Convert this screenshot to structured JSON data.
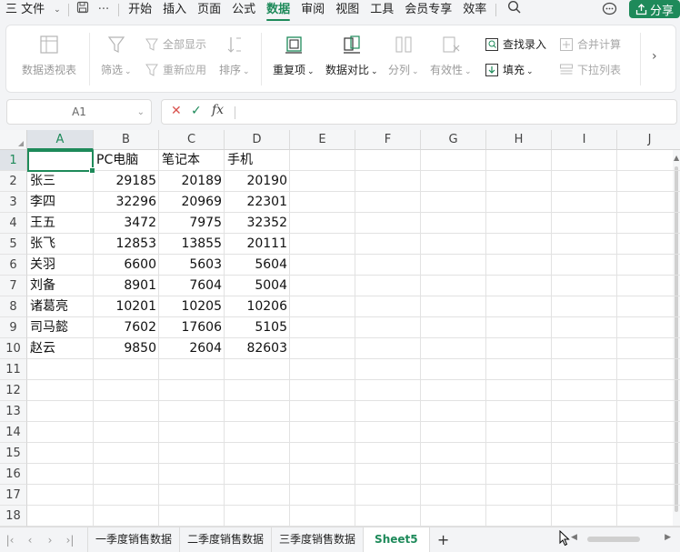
{
  "menubar": {
    "file_label": "三 文件",
    "ellipsis": "···",
    "tabs": [
      "开始",
      "插入",
      "页面",
      "公式",
      "数据",
      "审阅",
      "视图",
      "工具",
      "会员专享",
      "效率"
    ],
    "active_tab": "数据",
    "share_label": "分享"
  },
  "ribbon": {
    "pivot_table": "数据透视表",
    "filter": "筛选",
    "show_all": "全部显示",
    "reapply": "重新应用",
    "sort": "排序",
    "duplicates": "重复项",
    "compare": "数据对比",
    "split": "分列",
    "validity": "有效性",
    "lookup_entry": "查找录入",
    "fill": "填充",
    "merge_calc": "合并计算",
    "dropdown_list": "下拉列表"
  },
  "formula_bar": {
    "name_box": "A1",
    "fx": "fx",
    "content": ""
  },
  "sheet": {
    "columns": [
      "A",
      "B",
      "C",
      "D",
      "E",
      "F",
      "G",
      "H",
      "I",
      "J"
    ],
    "rows": [
      "1",
      "2",
      "3",
      "4",
      "5",
      "6",
      "7",
      "8",
      "9",
      "10",
      "11",
      "12",
      "13",
      "14",
      "15",
      "16",
      "17",
      "18"
    ],
    "header_row": [
      "",
      "PC电脑",
      "笔记本",
      "手机"
    ],
    "data": [
      [
        "张三",
        "29185",
        "20189",
        "20190"
      ],
      [
        "李四",
        "32296",
        "20969",
        "22301"
      ],
      [
        "王五",
        "3472",
        "7975",
        "32352"
      ],
      [
        "张飞",
        "12853",
        "13855",
        "20111"
      ],
      [
        "关羽",
        "6600",
        "5603",
        "5604"
      ],
      [
        "刘备",
        "8901",
        "7604",
        "5004"
      ],
      [
        "诸葛亮",
        "10201",
        "10205",
        "10206"
      ],
      [
        "司马懿",
        "7602",
        "17606",
        "5105"
      ],
      [
        "赵云",
        "9850",
        "2604",
        "82603"
      ]
    ],
    "active_cell": "A1"
  },
  "tabs": {
    "sheets": [
      "一季度销售数据",
      "二季度销售数据",
      "三季度销售数据",
      "Sheet5"
    ],
    "active": "Sheet5",
    "add": "+"
  },
  "colors": {
    "accent": "#1e8a5a",
    "cancel": "#d9534f"
  }
}
